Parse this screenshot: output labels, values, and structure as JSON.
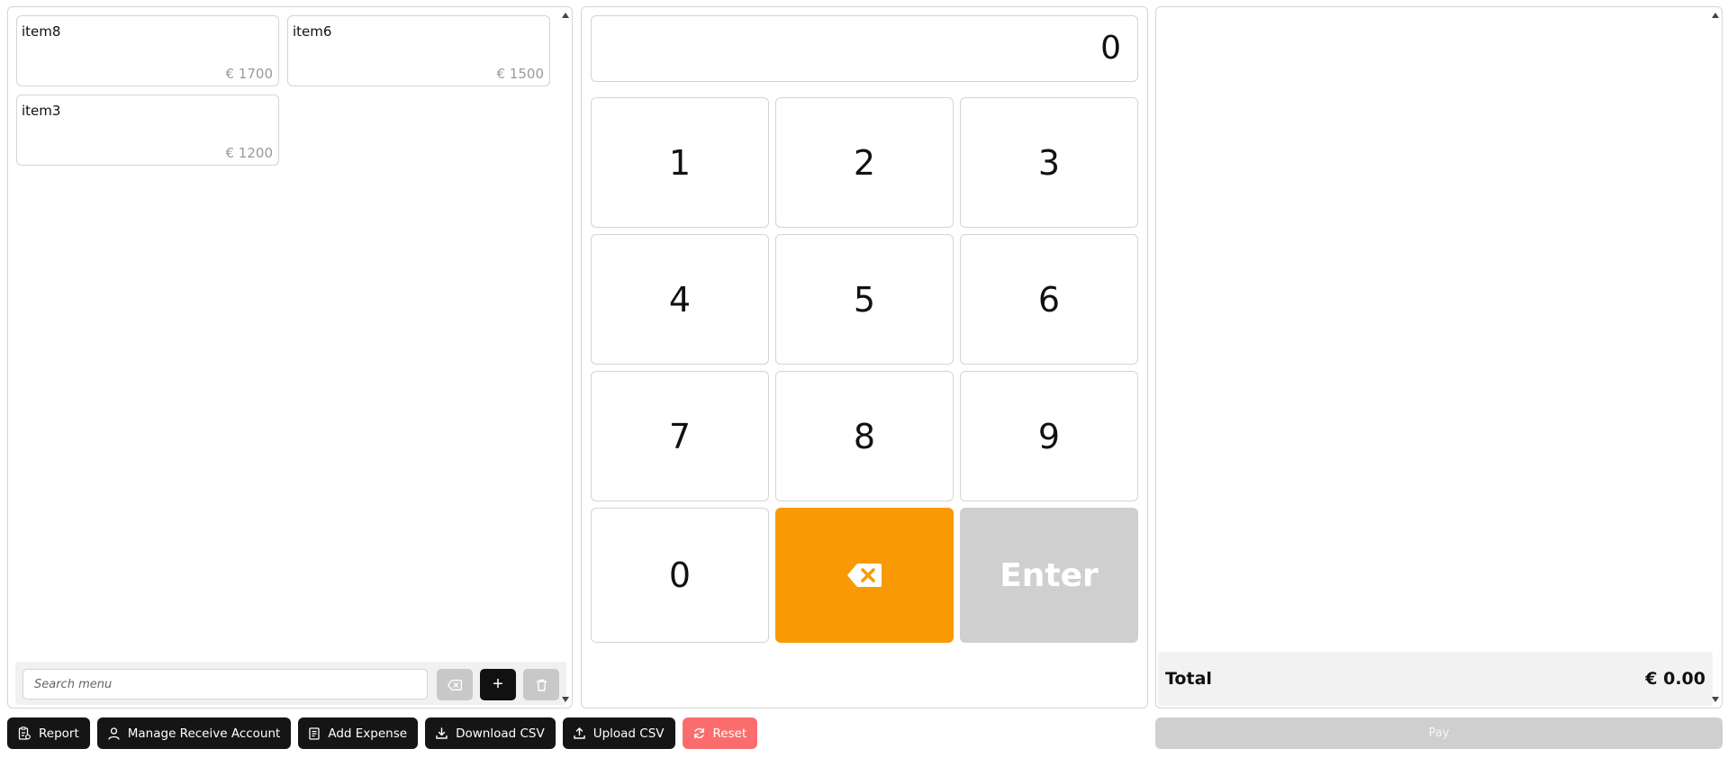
{
  "menu": {
    "items": [
      {
        "name": "item8",
        "price": "€ 1700"
      },
      {
        "name": "item6",
        "price": "€ 1500"
      },
      {
        "name": "item3",
        "price": "€ 1200"
      }
    ],
    "search_placeholder": "Search menu",
    "add_label": "+"
  },
  "keypad": {
    "display_value": "0",
    "keys": [
      "1",
      "2",
      "3",
      "4",
      "5",
      "6",
      "7",
      "8",
      "9",
      "0"
    ],
    "enter_label": "Enter",
    "backspace_icon": "backspace-icon",
    "accent_color": "#f99a04"
  },
  "cart": {
    "total_label": "Total",
    "total_value": "€ 0.00",
    "pay_label": "Pay"
  },
  "toolbar": {
    "report_label": "Report",
    "manage_label": "Manage Receive Account",
    "expense_label": "Add Expense",
    "download_label": "Download CSV",
    "upload_label": "Upload CSV",
    "reset_label": "Reset",
    "reset_color": "#fb6d6d"
  }
}
